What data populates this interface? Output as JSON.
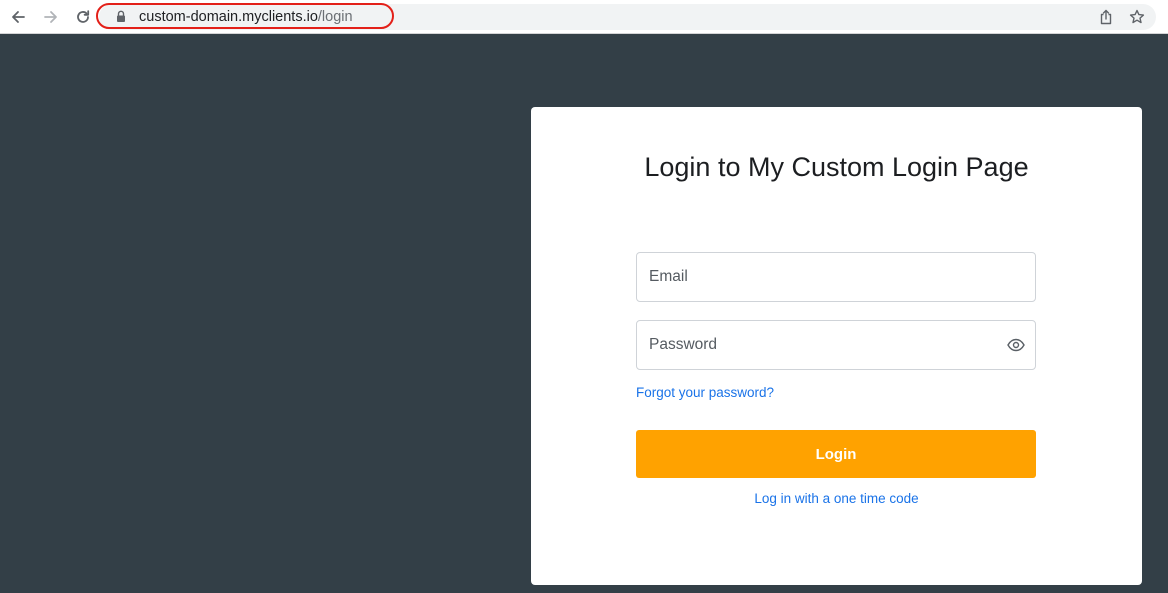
{
  "browser": {
    "url_domain": "custom-domain.myclients.io",
    "url_path": "/login",
    "highlight_color": "#e32019"
  },
  "login": {
    "title": "Login to My Custom Login Page",
    "email_placeholder": "Email",
    "password_placeholder": "Password",
    "forgot_password": "Forgot your password?",
    "login_button": "Login",
    "one_time_code": "Log in with a one time code"
  },
  "colors": {
    "page_background": "#333f47",
    "card_background": "#ffffff",
    "accent": "#ffa200",
    "link": "#1a73e8"
  }
}
